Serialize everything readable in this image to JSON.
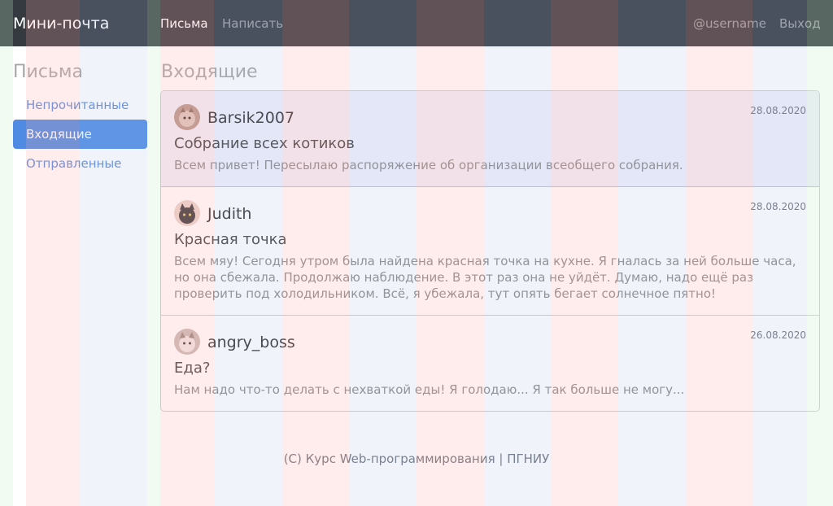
{
  "navbar": {
    "brand": "Мини-почта",
    "links": [
      {
        "label": "Письма",
        "active": true
      },
      {
        "label": "Написать",
        "active": false
      }
    ],
    "user": "@username",
    "logout": "Выход"
  },
  "sidebar": {
    "title": "Письма",
    "items": [
      {
        "label": "Непрочитанные",
        "active": false
      },
      {
        "label": "Входящие",
        "active": true
      },
      {
        "label": "Отправленные",
        "active": false
      }
    ]
  },
  "main": {
    "title": "Входящие",
    "messages": [
      {
        "sender": "Barsik2007",
        "date": "28.08.2020",
        "subject": "Собрание всех котиков",
        "preview": "Всем привет! Пересылаю распоряжение об организации всеобщего собрания."
      },
      {
        "sender": "Judith",
        "date": "28.08.2020",
        "subject": "Красная точка",
        "preview": "Всем мяу! Сегодня утром была найдена красная точка на кухне. Я гналась за ней больше часа, но она сбежала. Продолжаю наблюдение. В этот раз она не уйдёт. Думаю, надо ещё раз проверить под холодильником. Всё, я убежала, тут опять бегает солнечное пятно!"
      },
      {
        "sender": "angry_boss",
        "date": "26.08.2020",
        "subject": "Еда?",
        "preview": "Нам надо что-то делать с нехваткой еды! Я голодаю... Я так больше не могу..."
      }
    ]
  },
  "footer": {
    "text": "(C) Курс Web-программирования | ПГНИУ"
  },
  "colors": {
    "navbar_bg": "#343a40",
    "accent": "#4f8be3",
    "link": "#5a8be0"
  }
}
